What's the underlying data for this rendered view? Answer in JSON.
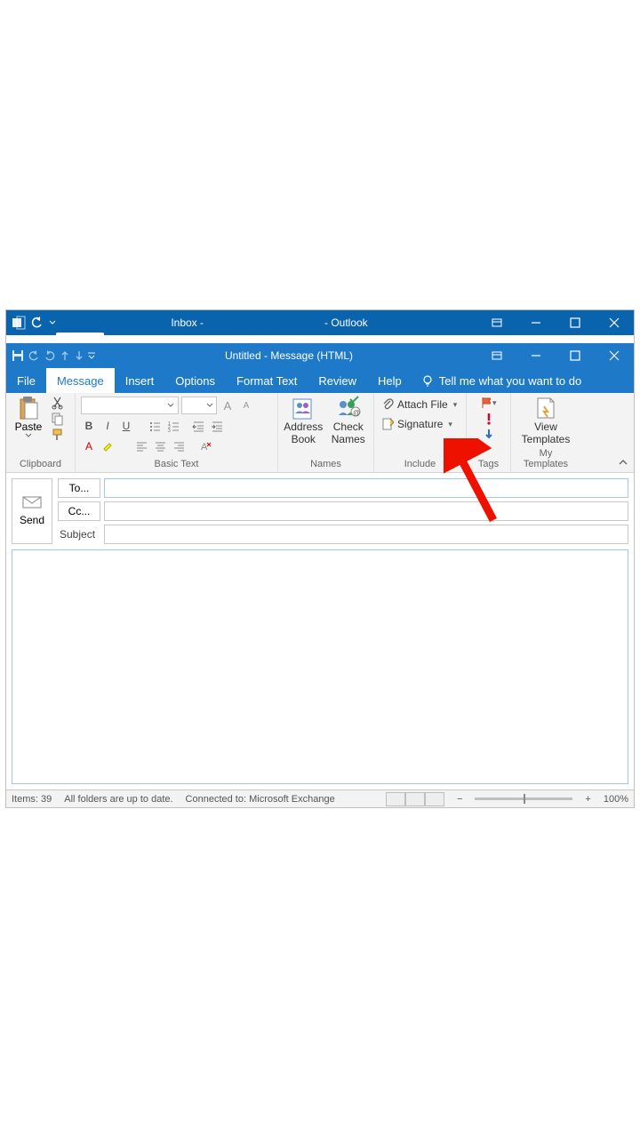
{
  "outlook_window": {
    "title_left": "Inbox -",
    "title_right": "- Outlook"
  },
  "message_window": {
    "title": "Untitled  -  Message (HTML)"
  },
  "ribbon_tabs": {
    "file": "File",
    "message": "Message",
    "insert": "Insert",
    "options": "Options",
    "format_text": "Format Text",
    "review": "Review",
    "help": "Help",
    "tell_me": "Tell me what you want to do"
  },
  "ribbon": {
    "clipboard": {
      "label": "Clipboard",
      "paste": "Paste"
    },
    "basic_text": {
      "label": "Basic Text"
    },
    "names": {
      "label": "Names",
      "address_book_l1": "Address",
      "address_book_l2": "Book",
      "check_names_l1": "Check",
      "check_names_l2": "Names"
    },
    "include": {
      "label": "Include",
      "attach_file": "Attach File",
      "signature": "Signature"
    },
    "tags": {
      "label": "Tags"
    },
    "my_templates": {
      "label": "My Templates",
      "view_l1": "View",
      "view_l2": "Templates"
    }
  },
  "compose": {
    "send": "Send",
    "to_btn": "To...",
    "cc_btn": "Cc...",
    "subject_label": "Subject",
    "to_value": "",
    "cc_value": "",
    "subject_value": ""
  },
  "statusbar": {
    "items": "Items: 39",
    "folders": "All folders are up to date.",
    "connected": "Connected to: Microsoft Exchange",
    "zoom": "100%"
  }
}
